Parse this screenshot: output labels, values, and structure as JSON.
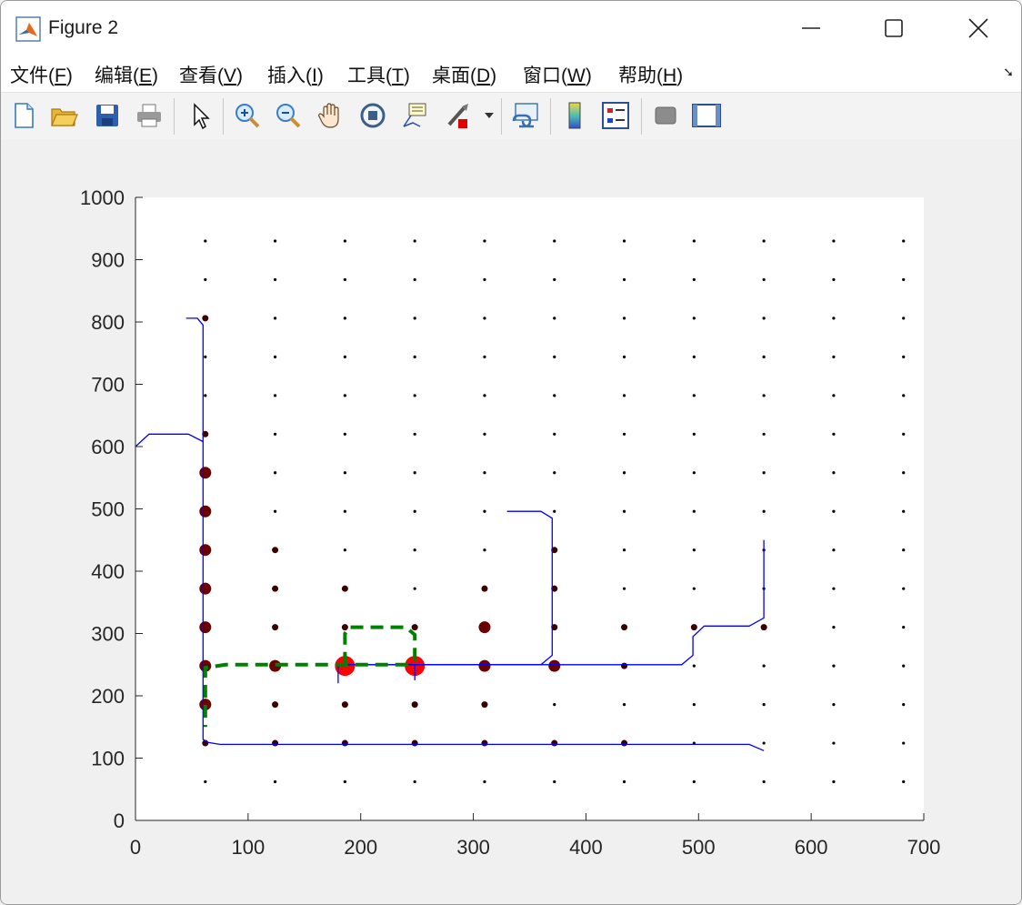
{
  "window": {
    "title": "Figure 2",
    "accent": "#0072bd"
  },
  "menubar": {
    "items": [
      {
        "label": "文件(",
        "key": "F",
        "suffix": ")"
      },
      {
        "label": "编辑(",
        "key": "E",
        "suffix": ")"
      },
      {
        "label": "查看(",
        "key": "V",
        "suffix": ")"
      },
      {
        "label": "插入(",
        "key": "I",
        "suffix": ")"
      },
      {
        "label": "工具(",
        "key": "T",
        "suffix": ")"
      },
      {
        "label": "桌面(",
        "key": "D",
        "suffix": ")"
      },
      {
        "label": "窗口(",
        "key": "W",
        "suffix": ")"
      },
      {
        "label": "帮助(",
        "key": "H",
        "suffix": ")"
      }
    ]
  },
  "toolbar": {
    "icons": [
      "new-figure-icon",
      "open-file-icon",
      "save-icon",
      "print-icon",
      "select-arrow-icon",
      "zoom-in-icon",
      "zoom-out-icon",
      "pan-hand-icon",
      "rotate-3d-icon",
      "data-cursor-icon",
      "brush-icon",
      "link-plot-icon",
      "colorbar-icon",
      "legend-icon",
      "hide-plot-tools-icon",
      "show-plot-tools-icon"
    ]
  },
  "chart_data": {
    "type": "scatter",
    "xlim": [
      0,
      700
    ],
    "ylim": [
      0,
      1000
    ],
    "xticks": [
      0,
      100,
      200,
      300,
      400,
      500,
      600,
      700
    ],
    "yticks": [
      0,
      100,
      200,
      300,
      400,
      500,
      600,
      700,
      800,
      900,
      1000
    ],
    "grid": false,
    "colors": {
      "path": "#0000ff",
      "route": "#008000",
      "small_point": "#000000",
      "medium_point": "#6b0000",
      "large_point": "#ff0000"
    },
    "grid_points": {
      "x": [
        62,
        124,
        186,
        248,
        310,
        372,
        434,
        496,
        558,
        620,
        682
      ],
      "y": [
        62,
        124,
        186,
        248,
        310,
        372,
        434,
        496,
        558,
        620,
        682,
        744,
        806,
        868,
        930
      ]
    },
    "highlighted_points": [
      {
        "x": 62,
        "y": 558,
        "level": 2
      },
      {
        "x": 62,
        "y": 496,
        "level": 2
      },
      {
        "x": 62,
        "y": 434,
        "level": 2
      },
      {
        "x": 62,
        "y": 372,
        "level": 2
      },
      {
        "x": 62,
        "y": 310,
        "level": 2
      },
      {
        "x": 62,
        "y": 248,
        "level": 2
      },
      {
        "x": 62,
        "y": 186,
        "level": 2
      },
      {
        "x": 62,
        "y": 620,
        "level": 1
      },
      {
        "x": 124,
        "y": 434,
        "level": 1
      },
      {
        "x": 124,
        "y": 372,
        "level": 1
      },
      {
        "x": 124,
        "y": 310,
        "level": 1
      },
      {
        "x": 124,
        "y": 248,
        "level": 2
      },
      {
        "x": 124,
        "y": 186,
        "level": 1
      },
      {
        "x": 186,
        "y": 310,
        "level": 1
      },
      {
        "x": 186,
        "y": 372,
        "level": 1
      },
      {
        "x": 186,
        "y": 186,
        "level": 1
      },
      {
        "x": 186,
        "y": 248,
        "level": 3
      },
      {
        "x": 248,
        "y": 310,
        "level": 1
      },
      {
        "x": 248,
        "y": 248,
        "level": 3
      },
      {
        "x": 248,
        "y": 186,
        "level": 1
      },
      {
        "x": 310,
        "y": 372,
        "level": 1
      },
      {
        "x": 310,
        "y": 310,
        "level": 2
      },
      {
        "x": 310,
        "y": 248,
        "level": 2
      },
      {
        "x": 310,
        "y": 186,
        "level": 1
      },
      {
        "x": 372,
        "y": 434,
        "level": 1
      },
      {
        "x": 372,
        "y": 372,
        "level": 1
      },
      {
        "x": 372,
        "y": 310,
        "level": 1
      },
      {
        "x": 372,
        "y": 248,
        "level": 2
      },
      {
        "x": 434,
        "y": 310,
        "level": 1
      },
      {
        "x": 434,
        "y": 248,
        "level": 1
      },
      {
        "x": 496,
        "y": 310,
        "level": 1
      },
      {
        "x": 558,
        "y": 310,
        "level": 1
      },
      {
        "x": 62,
        "y": 124,
        "level": 1
      },
      {
        "x": 124,
        "y": 124,
        "level": 1
      },
      {
        "x": 186,
        "y": 124,
        "level": 1
      },
      {
        "x": 248,
        "y": 124,
        "level": 1
      },
      {
        "x": 310,
        "y": 124,
        "level": 1
      },
      {
        "x": 372,
        "y": 124,
        "level": 1
      },
      {
        "x": 434,
        "y": 124,
        "level": 1
      },
      {
        "x": 62,
        "y": 806,
        "level": 1
      }
    ],
    "blue_paths": [
      [
        [
          45,
          806
        ],
        [
          55,
          806
        ],
        [
          60,
          795
        ],
        [
          60,
          130
        ],
        [
          65,
          125
        ],
        [
          75,
          122
        ],
        [
          545,
          122
        ],
        [
          558,
          112
        ]
      ],
      [
        [
          0,
          600
        ],
        [
          12,
          620
        ],
        [
          47,
          620
        ],
        [
          60,
          608
        ]
      ],
      [
        [
          330,
          496
        ],
        [
          360,
          496
        ],
        [
          370,
          485
        ],
        [
          370,
          265
        ],
        [
          360,
          250
        ],
        [
          180,
          250
        ],
        [
          180,
          220
        ]
      ],
      [
        [
          180,
          250
        ],
        [
          485,
          250
        ],
        [
          495,
          265
        ],
        [
          495,
          295
        ],
        [
          505,
          312
        ],
        [
          545,
          312
        ],
        [
          558,
          325
        ],
        [
          558,
          450
        ]
      ],
      [
        [
          248,
          250
        ],
        [
          248,
          225
        ]
      ]
    ],
    "green_route": [
      [
        186,
        250
      ],
      [
        186,
        300
      ],
      [
        190,
        310
      ],
      [
        240,
        310
      ],
      [
        248,
        298
      ],
      [
        248,
        258
      ],
      [
        240,
        250
      ],
      [
        80,
        250
      ],
      [
        62,
        245
      ],
      [
        62,
        150
      ]
    ]
  }
}
